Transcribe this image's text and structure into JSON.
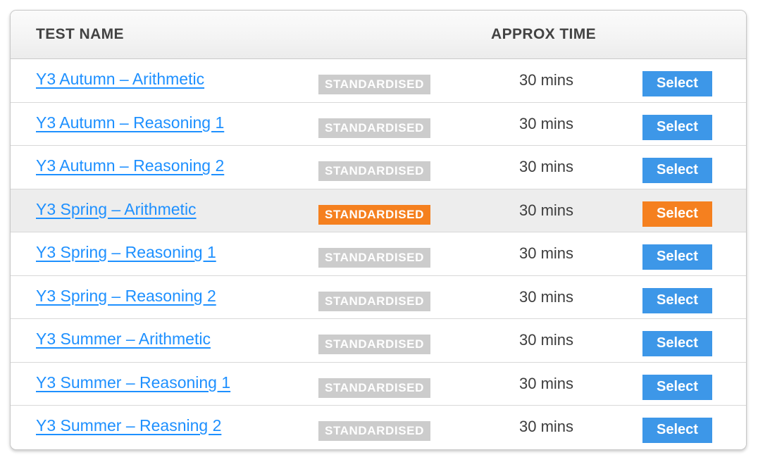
{
  "table": {
    "columns": {
      "test_name": "TEST NAME",
      "approx_time": "APPROX TIME"
    },
    "colors": {
      "link": "#1e90ff",
      "badge_default": "#cccccc",
      "badge_active": "#f5801f",
      "button_default": "#3d97e8",
      "button_active": "#f5801f",
      "row_highlight": "#ededed",
      "header_text": "#434343"
    },
    "rows": [
      {
        "name": "Y3 Autumn – Arithmetic",
        "badge": "STANDARDISED",
        "time": "30 mins",
        "action": "Select",
        "selected": false
      },
      {
        "name": "Y3 Autumn – Reasoning 1",
        "badge": "STANDARDISED",
        "time": "30 mins",
        "action": "Select",
        "selected": false
      },
      {
        "name": "Y3 Autumn – Reasoning 2",
        "badge": "STANDARDISED",
        "time": "30 mins",
        "action": "Select",
        "selected": false
      },
      {
        "name": "Y3 Spring – Arithmetic",
        "badge": "STANDARDISED",
        "time": "30 mins",
        "action": "Select",
        "selected": true
      },
      {
        "name": "Y3 Spring – Reasoning 1",
        "badge": "STANDARDISED",
        "time": "30 mins",
        "action": "Select",
        "selected": false
      },
      {
        "name": "Y3 Spring – Reasoning 2",
        "badge": "STANDARDISED",
        "time": "30 mins",
        "action": "Select",
        "selected": false
      },
      {
        "name": "Y3 Summer – Arithmetic",
        "badge": "STANDARDISED",
        "time": "30 mins",
        "action": "Select",
        "selected": false
      },
      {
        "name": "Y3 Summer – Reasoning 1",
        "badge": "STANDARDISED",
        "time": "30 mins",
        "action": "Select",
        "selected": false
      },
      {
        "name": "Y3 Summer – Reasning 2",
        "badge": "STANDARDISED",
        "time": "30 mins",
        "action": "Select",
        "selected": false
      }
    ]
  }
}
